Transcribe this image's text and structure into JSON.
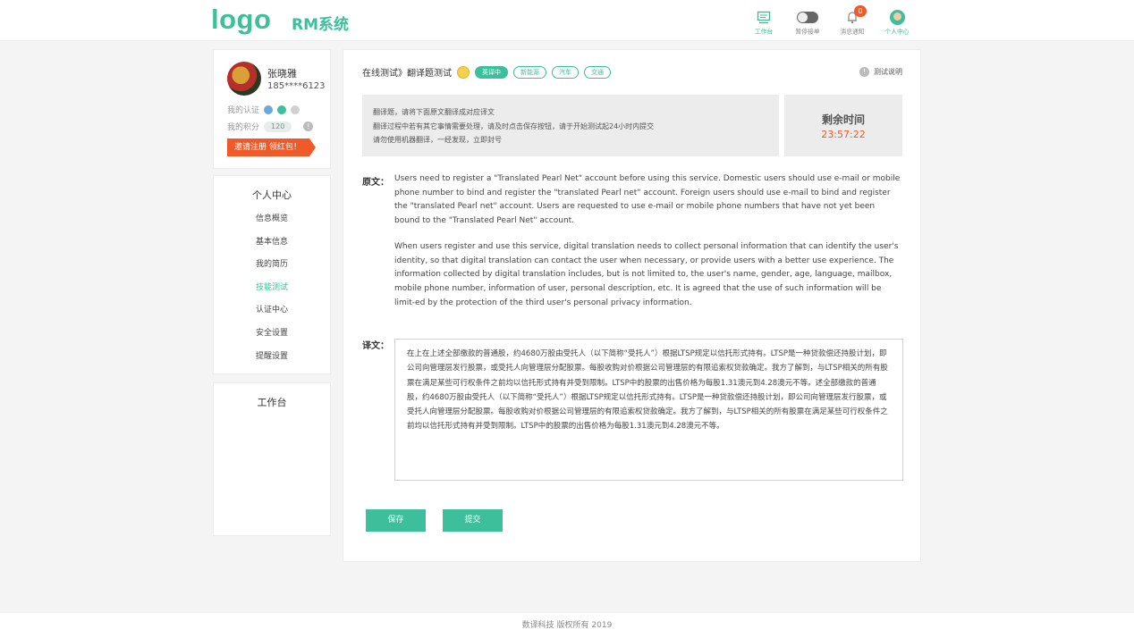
{
  "header": {
    "logo": "logo",
    "system_name": "RM系统",
    "nav": {
      "workbench": "工作台",
      "pause_orders": "暂停接单",
      "messages": "消息通知",
      "messages_count": "0",
      "personal_center": "个人中心"
    }
  },
  "profile": {
    "name": "张晓雅",
    "phone": "185****6123",
    "cert_label": "我的认证",
    "points_label": "我的积分",
    "points_value": "120",
    "info_icon_text": "!",
    "invite_label": "邀请注册 领红包！"
  },
  "menu": {
    "title": "个人中心",
    "items": [
      "信息概览",
      "基本信息",
      "我的简历",
      "技能测试",
      "认证中心",
      "安全设置",
      "提醒设置"
    ]
  },
  "workbench": {
    "title": "工作台"
  },
  "main": {
    "breadcrumb": "在线测试》翻译题测试",
    "tags": [
      "英译中",
      "新能源",
      "汽车",
      "交通"
    ],
    "explain_label": "测试说明",
    "notice": [
      "翻译题，请将下面原文翻译成对应译文",
      "翻译过程中若有其它事情需要处理，请及时点击保存按钮，请于开始测试起24小时内提交",
      "请勿使用机器翻译，一经发现，立即封号"
    ],
    "timer_label": "剩余时间",
    "timer_value": "23:57:22",
    "original_label": "原文：",
    "original_paragraphs": [
      "Users need to register a \"Translated Pearl Net\" account before using this service. Domestic users should use e-mail or mobile phone number to bind and register the \"translated Pearl net\" account. Foreign users should use e-mail to bind and register the \"translated Pearl net\" account. Users are requested to use e-mail or mobile phone numbers that have not yet been bound to the \"Translated Pearl Net\" account.",
      "When users register and use this service, digital translation needs to collect personal information that can identify the user's identity, so that digital translation can contact the user when necessary, or provide users with a better use experience. The information collected by digital translation includes, but is not limited to, the user's name, gender, age, language, mailbox, mobile phone number, information of user, personal description, etc. It is agreed that the use of such information will be limit-ed by the protection of the third user's personal privacy information."
    ],
    "translation_label": "译文：",
    "translation_text": "在上在上述全部缴款的普通股，约4680万股由受托人（以下简称“受托人”）根据LTSP规定以信托形式持有。LTSP是一种贷款偿还持股计划，即公司向管理层发行股票，或受托人向管理层分配股票。每股收购对价根据公司管理层的有限追索权贷款确定。我方了解到，与LTSP相关的所有股票在满足某些可行权条件之前均以信托形式持有并受到限制。LTSP中的股票的出售价格为每股1.31澳元到4.28澳元不等。述全部缴款的普通股，约4680万股由受托人（以下简称“受托人”）根据LTSP规定以信托形式持有。LTSP是一种贷款偿还持股计划，即公司向管理层发行股票，或受托人向管理层分配股票。每股收购对价根据公司管理层的有限追索权贷款确定。我方了解到，与LTSP相关的所有股票在满足某些可行权条件之前均以信托形式持有并受到限制。LTSP中的股票的出售价格为每股1.31澳元到4.28澳元不等。",
    "save_button": "保存",
    "submit_button": "提交"
  },
  "footer": {
    "copyright": "数译科技 版权所有 2019"
  },
  "colors": {
    "accent": "#3cbf9a",
    "warning": "#f05a28"
  }
}
